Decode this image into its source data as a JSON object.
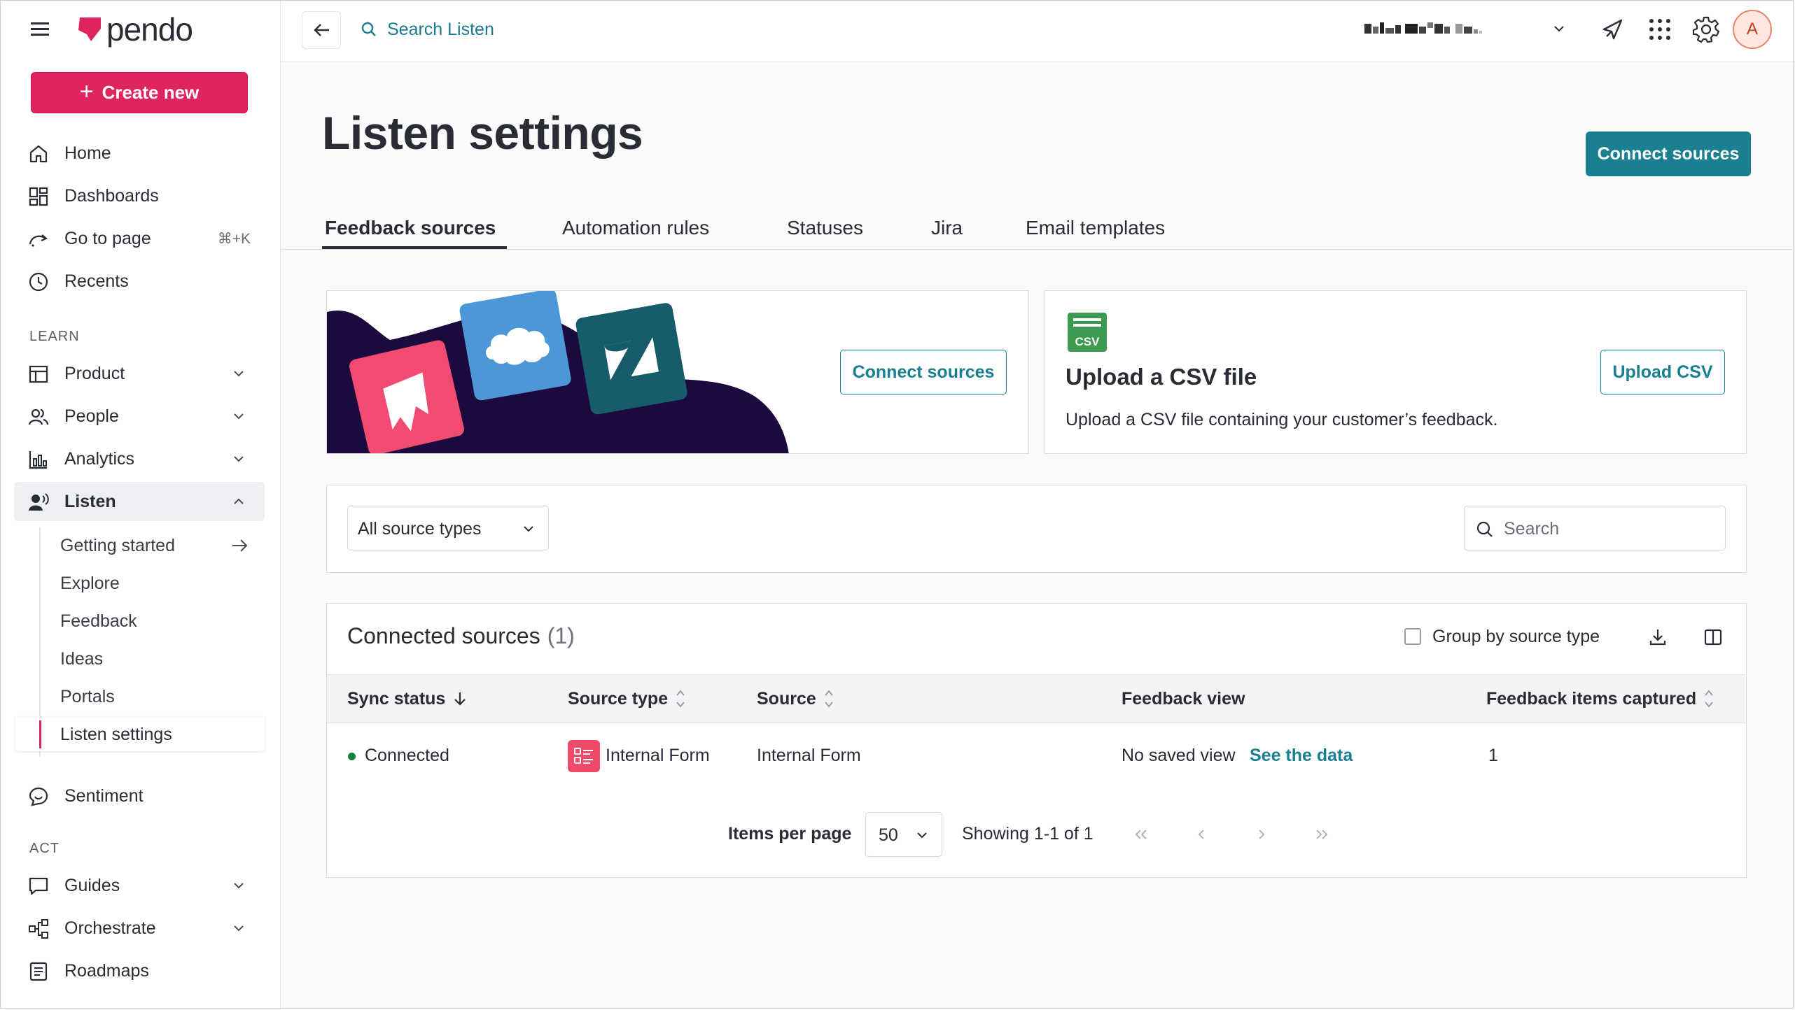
{
  "app": {
    "logo_text": "pendo",
    "brand_color": "#e0245f",
    "accent_color": "#1a7f91"
  },
  "sidebar": {
    "create_label": "Create new",
    "nav_top": [
      {
        "label": "Home",
        "icon": "home-icon"
      },
      {
        "label": "Dashboards",
        "icon": "dashboards-icon"
      },
      {
        "label": "Go to page",
        "icon": "go-to-page-icon",
        "shortcut": "⌘+K"
      },
      {
        "label": "Recents",
        "icon": "clock-icon"
      }
    ],
    "learn_heading": "LEARN",
    "learn_items": [
      {
        "label": "Product"
      },
      {
        "label": "People"
      },
      {
        "label": "Analytics"
      },
      {
        "label": "Listen"
      }
    ],
    "listen_sub": [
      {
        "label": "Getting started"
      },
      {
        "label": "Explore"
      },
      {
        "label": "Feedback"
      },
      {
        "label": "Ideas"
      },
      {
        "label": "Portals"
      },
      {
        "label": "Listen settings"
      }
    ],
    "sentiment_label": "Sentiment",
    "act_heading": "ACT",
    "act_items": [
      {
        "label": "Guides"
      },
      {
        "label": "Orchestrate"
      },
      {
        "label": "Roadmaps"
      }
    ]
  },
  "topbar": {
    "search_label": "Search Listen",
    "avatar_initial": "A"
  },
  "page": {
    "title": "Listen settings",
    "connect_btn": "Connect sources",
    "tabs": [
      "Feedback sources",
      "Automation rules",
      "Statuses",
      "Jira",
      "Email templates"
    ]
  },
  "promo": {
    "connect_btn": "Connect sources"
  },
  "csv": {
    "icon_text": "CSV",
    "title": "Upload a CSV file",
    "desc": "Upload a CSV file containing your customer’s feedback.",
    "button": "Upload CSV"
  },
  "filters": {
    "source_type": "All source types",
    "search_placeholder": "Search"
  },
  "table": {
    "title": "Connected sources",
    "count": "(1)",
    "group_label": "Group by source type",
    "columns": [
      "Sync status",
      "Source type",
      "Source",
      "Feedback view",
      "Feedback items captured"
    ],
    "rows": [
      {
        "status": "Connected",
        "source_type": "Internal Form",
        "source": "Internal Form",
        "view": "No saved view",
        "view_link": "See the data",
        "items": "1"
      }
    ]
  },
  "pagination": {
    "items_label": "Items per page",
    "per_page": "50",
    "showing": "Showing 1-1 of 1"
  }
}
